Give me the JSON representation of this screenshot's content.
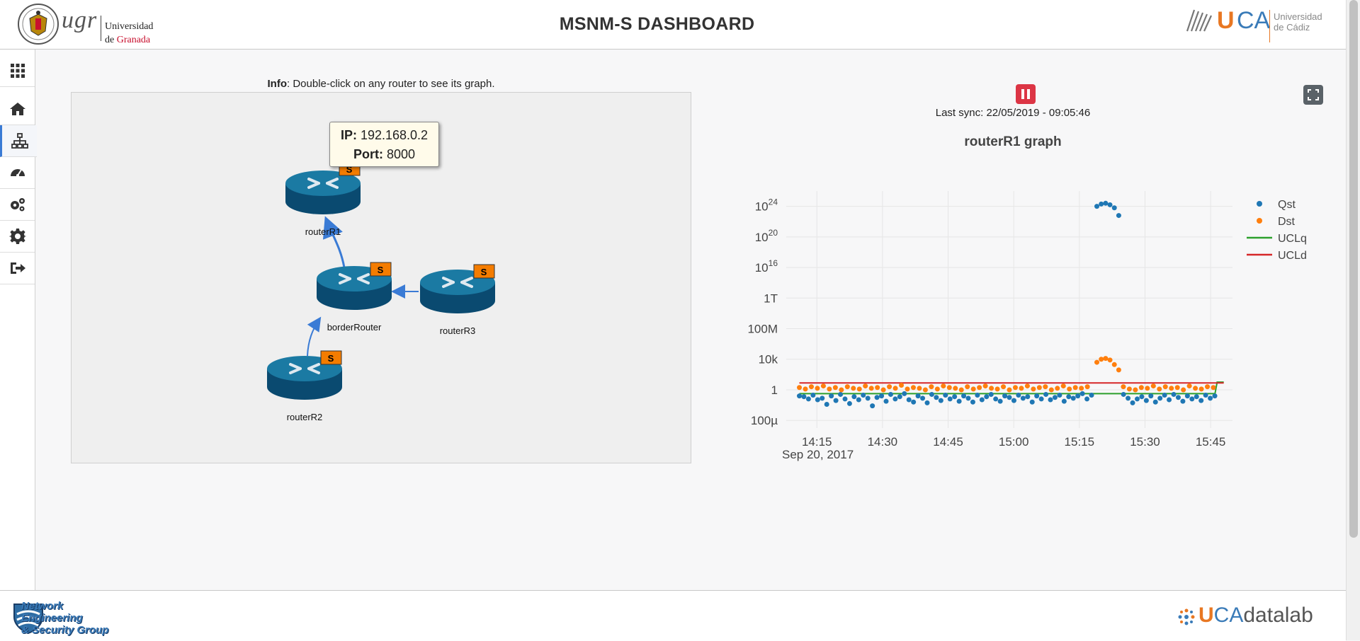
{
  "header": {
    "title": "MSNM-S DASHBOARD",
    "ugr_logo_text": "ugr",
    "ugr_name_line1": "Universidad",
    "ugr_name_de": "de",
    "ugr_name_granada": "Granada",
    "uca_logo_u": "U",
    "uca_logo_ca": "CA",
    "uca_name_line1": "Universidad",
    "uca_name_line2": "de Cádiz"
  },
  "sidebar": {
    "items": [
      {
        "icon": "grid-icon",
        "active": false
      },
      {
        "icon": "home-icon",
        "active": false
      },
      {
        "icon": "network-icon",
        "active": true
      },
      {
        "icon": "dashboard-gauge-icon",
        "active": false
      },
      {
        "icon": "gears-icon",
        "active": false
      },
      {
        "icon": "settings-icon",
        "active": false
      },
      {
        "icon": "logout-icon",
        "active": false
      }
    ]
  },
  "info": {
    "label": "Info",
    "text": ": Double-click on any router to see its graph."
  },
  "topology": {
    "nodes": [
      {
        "id": "routerR1",
        "label": "routerR1",
        "badge": "S"
      },
      {
        "id": "borderRouter",
        "label": "borderRouter",
        "badge": "S"
      },
      {
        "id": "routerR3",
        "label": "routerR3",
        "badge": "S"
      },
      {
        "id": "routerR2",
        "label": "routerR2",
        "badge": "S"
      }
    ],
    "tooltip": {
      "ip_label": "IP:",
      "ip_value": "192.168.0.2",
      "port_label": "Port:",
      "port_value": "8000"
    }
  },
  "status": {
    "last_sync": "Last sync: 22/05/2019 - 09:05:46"
  },
  "chart_data": {
    "type": "scatter",
    "title": "routerR1 graph",
    "y_scale": "log",
    "x_ticks": [
      "14:15",
      "14:30",
      "14:45",
      "15:00",
      "15:15",
      "15:30",
      "15:45"
    ],
    "x_date_label": "Sep 20, 2017",
    "y_ticks": [
      {
        "label": "100µ",
        "value": 0.0001
      },
      {
        "label": "1",
        "value": 1
      },
      {
        "label": "10k",
        "value": 10000.0
      },
      {
        "label": "100M",
        "value": 100000000.0
      },
      {
        "label": "1T",
        "value": 1000000000000.0
      },
      {
        "label": "10",
        "sup": "16",
        "value": 1e+16
      },
      {
        "label": "10",
        "sup": "20",
        "value": 1e+20
      },
      {
        "label": "10",
        "sup": "24",
        "value": 1e+24
      }
    ],
    "x_range": [
      "14:08",
      "15:50"
    ],
    "ylim": [
      1e-05,
      1e+26
    ],
    "grid": true,
    "legend_position": "top-right",
    "series": [
      {
        "name": "Qst",
        "kind": "points",
        "color": "#1f77b4",
        "start": "14:11",
        "step_minutes": 1,
        "log10_values": [
          -0.8,
          -0.9,
          -1.2,
          -0.7,
          -1.3,
          -1.1,
          -1.9,
          -0.8,
          -1.4,
          -0.6,
          -1.2,
          -1.8,
          -0.9,
          -1.3,
          -0.7,
          -1.1,
          -2.1,
          -1.0,
          -0.8,
          -1.5,
          -0.6,
          -1.2,
          -0.9,
          -0.5,
          -1.3,
          -1.6,
          -0.8,
          -1.1,
          -1.7,
          -0.6,
          -1.0,
          -1.4,
          -0.7,
          -1.2,
          -0.9,
          -1.5,
          -0.8,
          -1.1,
          -1.6,
          -0.7,
          -1.3,
          -0.9,
          -0.6,
          -1.2,
          -1.5,
          -0.8,
          -1.0,
          -1.4,
          -0.7,
          -1.1,
          -0.9,
          -1.6,
          -0.8,
          -1.2,
          -0.6,
          -1.3,
          -1.0,
          -0.7,
          -1.5,
          -0.9,
          -1.1,
          -0.8,
          -0.5,
          -1.2,
          -0.7,
          -1.4,
          -0.9,
          -1.0,
          -1.6,
          -0.8,
          -1.3,
          -0.6,
          -1.1,
          -1.7,
          -1.2,
          -0.9,
          -1.4,
          -0.8,
          -1.6,
          -1.1,
          -0.7,
          -1.3,
          -0.6,
          -1.0,
          -1.5,
          -0.8,
          -1.2,
          -0.9,
          -1.4,
          -0.7,
          -1.1,
          -0.8
        ],
        "notes": "gap at index 79-85"
      },
      {
        "name": "Dst",
        "kind": "points",
        "color": "#ff7f0e",
        "start": "14:11",
        "step_minutes": 1,
        "log10_values": [
          0.3,
          0.1,
          0.4,
          0.2,
          0.5,
          0.1,
          0.3,
          0.0,
          0.4,
          0.2,
          0.1,
          0.5,
          0.2,
          0.3,
          0.0,
          0.4,
          0.2,
          0.6,
          0.1,
          0.3,
          0.2,
          0.0,
          0.4,
          0.1,
          0.5,
          0.3,
          0.2,
          0.0,
          0.4,
          0.1,
          0.3,
          0.5,
          0.2,
          0.1,
          0.4,
          0.0,
          0.3,
          0.2,
          0.5,
          0.1,
          0.3,
          0.4,
          0.0,
          0.2,
          0.5,
          0.1,
          0.3,
          0.2,
          0.4,
          0.0,
          0.1,
          0.3,
          0.5,
          0.2,
          0.4,
          0.1,
          0.0,
          0.3,
          0.2,
          0.5,
          0.1,
          0.4,
          0.2,
          0.3,
          0.0,
          0.5,
          0.2,
          0.1,
          0.4,
          0.3
        ]
      }
    ],
    "qst_peak": {
      "times": [
        "15:19",
        "15:20",
        "15:21",
        "15:22",
        "15:23",
        "15:24"
      ],
      "log10_values": [
        24.0,
        24.3,
        24.4,
        24.2,
        23.8,
        22.8
      ]
    },
    "dst_peak": {
      "times": [
        "15:19",
        "15:20",
        "15:21",
        "15:22",
        "15:23",
        "15:24"
      ],
      "log10_values": [
        3.6,
        4.0,
        4.1,
        3.9,
        3.3,
        2.6
      ]
    },
    "lines": [
      {
        "name": "UCLq",
        "color": "#2ca02c",
        "log10_value": -0.5,
        "end_log10_value": 1.0
      },
      {
        "name": "UCLd",
        "color": "#d62728",
        "log10_value": 0.9,
        "end_log10_value": 0.9
      }
    ]
  },
  "footer": {
    "nesg_line1": "Network Engineering",
    "nesg_line2": "& Security Group",
    "ucadl_u": "U",
    "ucadl_ca": "CA",
    "ucadl_rest": "datalab"
  }
}
